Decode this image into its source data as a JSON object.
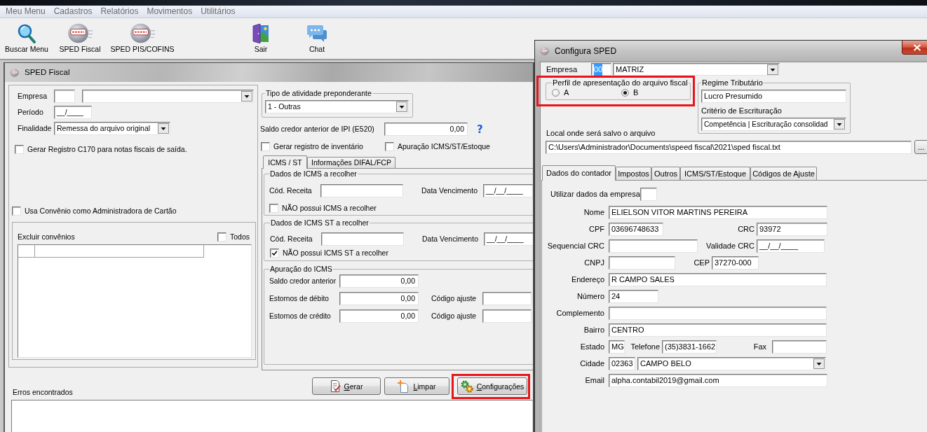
{
  "menu_bar": [
    "Meu Menu",
    "Cadastros",
    "Relatórios",
    "Movimentos",
    "Utilitários"
  ],
  "toolbar": [
    {
      "label": "Buscar Menu",
      "kind": "search"
    },
    {
      "label": "SPED Fiscal",
      "kind": "sped"
    },
    {
      "label": "SPED PIS/COFINS",
      "kind": "sped"
    },
    {
      "label": "Sair",
      "kind": "exit"
    },
    {
      "label": "Chat",
      "kind": "chat"
    }
  ],
  "sped_fiscal": {
    "title": "SPED Fiscal",
    "empresa": {
      "label": "Empresa"
    },
    "periodo": {
      "label": "Período",
      "value": "__/____"
    },
    "finalidade": {
      "label": "Finalidade",
      "value": "Remessa do arquivo original"
    },
    "gerar_c170": {
      "label": "Gerar Registro C170 para notas fiscais de saída.",
      "checked": false
    },
    "usa_convenio": {
      "label": "Usa Convênio como Administradora de Cartão",
      "checked": false
    },
    "excluir_convenios": {
      "label": "Excluir convênios",
      "todos": {
        "label": "Todos",
        "checked": false
      }
    },
    "tipo_atividade": {
      "title": "Tipo de atividade preponderante",
      "value": "1 - Outras"
    },
    "saldo_ipi": {
      "label": "Saldo credor anterior de IPI (E520)",
      "value": "0,00",
      "help": "?"
    },
    "options": [
      {
        "label": "Gerar registro de inventário",
        "checked": false
      },
      {
        "label": "Apuração ICMS/ST/Estoque",
        "checked": false
      }
    ],
    "tabs": [
      {
        "label": "ICMS / ST",
        "selected": true
      },
      {
        "label": "Informações DIFAL/FCP",
        "selected": false
      }
    ],
    "recolher": [
      {
        "title": "Dados de ICMS a recolher",
        "receita_label": "Cód. Receita",
        "vencimento_label": "Data Vencimento",
        "vencimento": "__/__/____",
        "nao_possui": {
          "label": "NÃO possui ICMS a recolher",
          "checked": false
        }
      },
      {
        "title": "Dados de ICMS ST a recolher",
        "receita_label": "Cód. Receita",
        "vencimento_label": "Data Vencimento",
        "vencimento": "__/__/____",
        "nao_possui": {
          "label": "NÃO possui ICMS ST a recolher",
          "checked": true
        }
      }
    ],
    "apuracao": {
      "title": "Apuração do ICMS",
      "rows": [
        {
          "label": "Saldo credor anterior",
          "value": "0,00"
        },
        {
          "label": "Estornos de débito",
          "value": "0,00",
          "ajuste_label": "Código ajuste"
        },
        {
          "label": "Estornos de crédito",
          "value": "0,00",
          "ajuste_label": "Código ajuste"
        }
      ]
    },
    "buttons": [
      {
        "label": "Gerar",
        "kind": "generate",
        "highlighted": false
      },
      {
        "label": "Limpar",
        "kind": "clear",
        "highlighted": false
      },
      {
        "label": "Configurações",
        "kind": "settings",
        "highlighted": true
      }
    ],
    "erros": {
      "label": "Erros encontrados"
    }
  },
  "configura_sped": {
    "title": "Configura SPED",
    "empresa": {
      "label": "Empresa",
      "code": "00",
      "code_selected": true,
      "name": "MATRIZ"
    },
    "perfil": {
      "title": "Perfil de apresentação do arquivo fiscal",
      "highlighted": true,
      "options": [
        {
          "label": "A",
          "selected": false
        },
        {
          "label": "B",
          "selected": true
        }
      ]
    },
    "regime": {
      "title": "Regime Tributário",
      "value": "Lucro Presumido",
      "criterio_label": "Critério de Escrituração",
      "criterio": "Competência | Escrituração consolidad"
    },
    "local": {
      "label": "Local onde será salvo o arquivo",
      "value": "C:\\Users\\Administrador\\Documents\\speed fiscal\\2021\\sped fiscal.txt",
      "browse": "..."
    },
    "tabs": [
      {
        "label": "Dados do contador",
        "selected": true
      },
      {
        "label": "Impostos",
        "selected": false
      },
      {
        "label": "Outros",
        "selected": false
      },
      {
        "label": "ICMS/ST/Estoque",
        "selected": false
      },
      {
        "label": "Códigos de Ajuste",
        "selected": false
      }
    ],
    "contador": {
      "utilizar": {
        "label": "Utilizar dados da empresa"
      },
      "nome": {
        "label": "Nome",
        "value": "ELIELSON VITOR MARTINS PEREIRA"
      },
      "cpf": {
        "label": "CPF",
        "value": "03696748633"
      },
      "crc": {
        "label": "CRC",
        "value": "93972"
      },
      "sequencial_crc": {
        "label": "Sequencial CRC"
      },
      "validade_crc": {
        "label": "Validade CRC",
        "value": "__/__/____"
      },
      "cnpj": {
        "label": "CNPJ"
      },
      "cep": {
        "label": "CEP",
        "value": "37270-000"
      },
      "endereco": {
        "label": "Endereço",
        "value": "R CAMPO SALES"
      },
      "numero": {
        "label": "Número",
        "value": "24"
      },
      "complemento": {
        "label": "Complemento"
      },
      "bairro": {
        "label": "Bairro",
        "value": "CENTRO"
      },
      "estado": {
        "label": "Estado",
        "value": "MG"
      },
      "telefone": {
        "label": "Telefone",
        "value": "(35)3831-1662"
      },
      "fax": {
        "label": "Fax"
      },
      "cidade": {
        "label": "Cidade",
        "code": "02363",
        "name": "CAMPO BELO"
      },
      "email": {
        "label": "Email",
        "value": "alpha.contabil2019@gmail.com"
      }
    }
  }
}
